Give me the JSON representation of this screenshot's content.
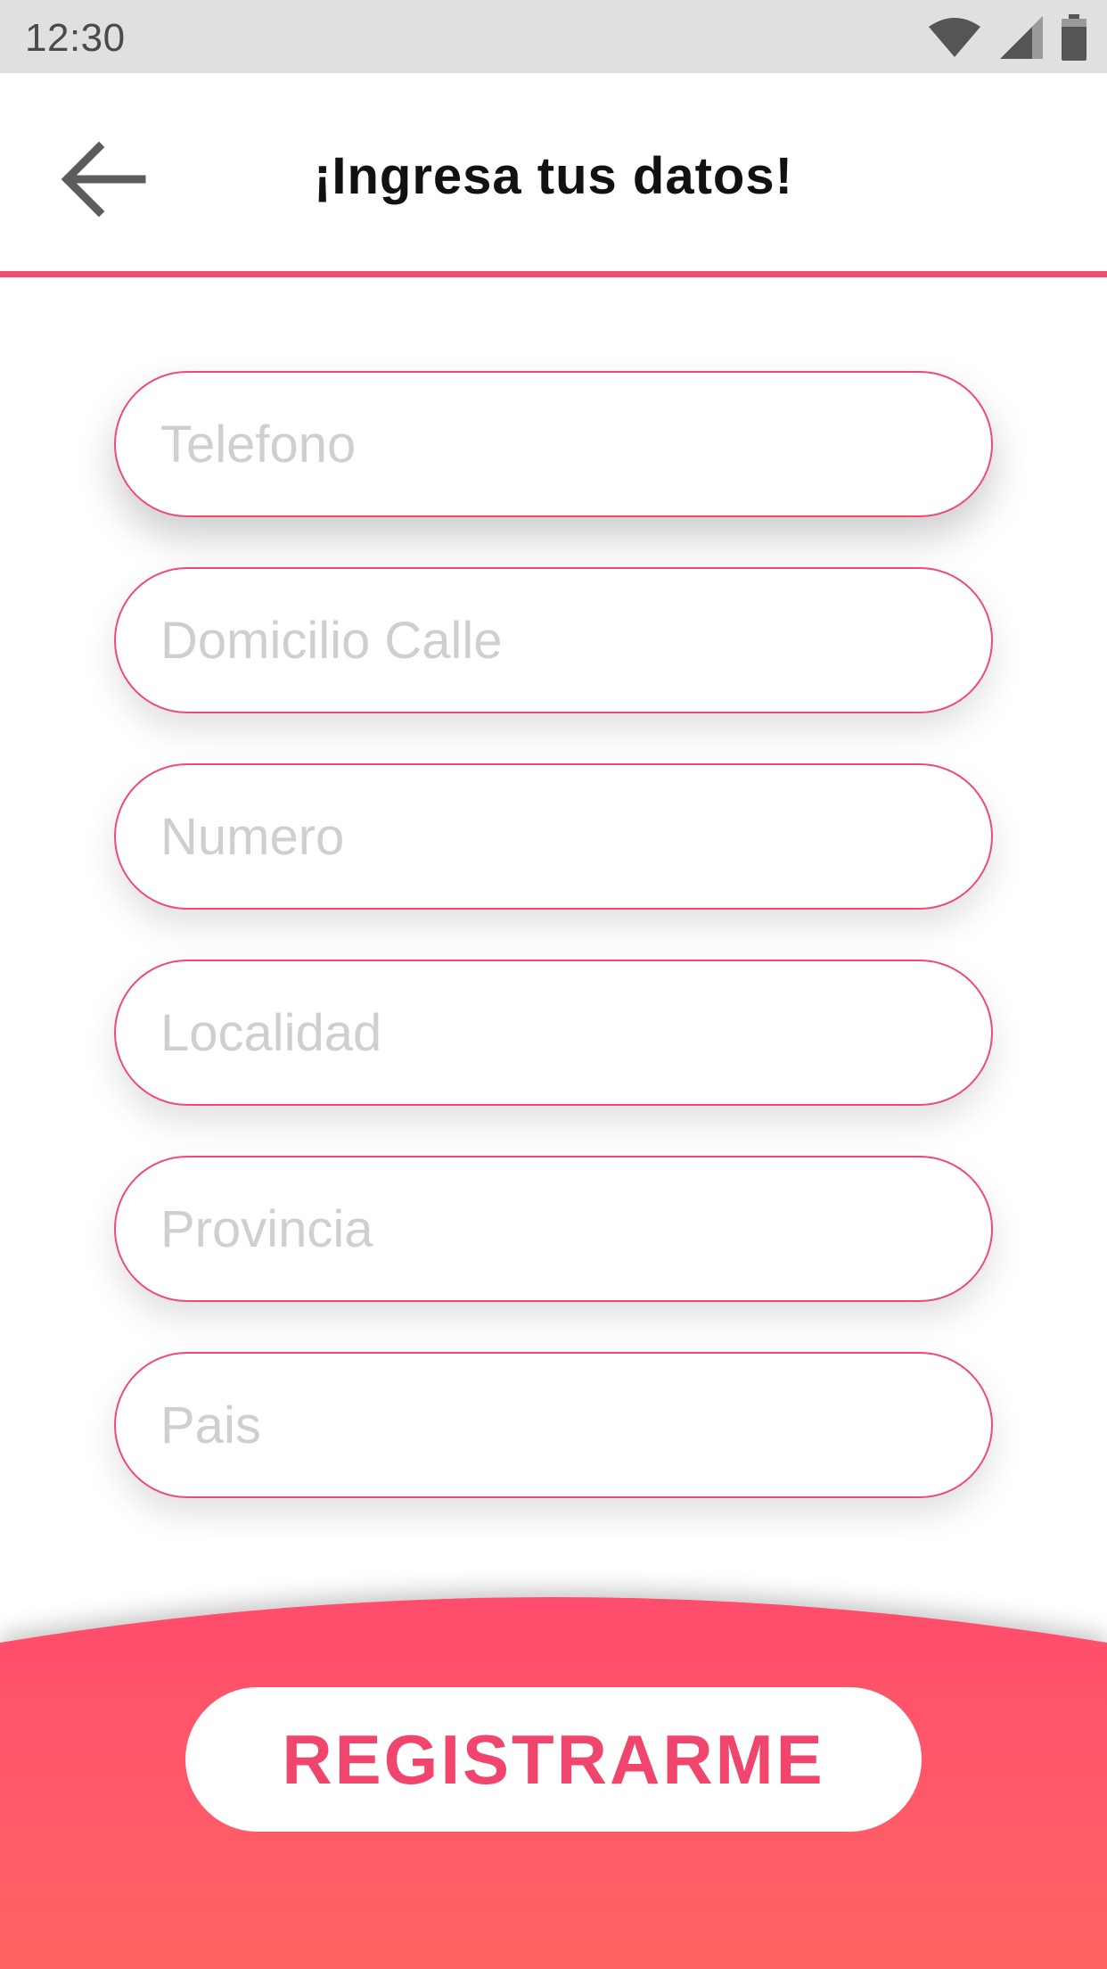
{
  "status_bar": {
    "time": "12:30",
    "icons": [
      "wifi-icon",
      "signal-icon",
      "battery-icon"
    ]
  },
  "header": {
    "back_icon": "arrow-left-icon",
    "title": "¡Ingresa tus datos!"
  },
  "form": {
    "fields": [
      {
        "placeholder": "Telefono",
        "value": ""
      },
      {
        "placeholder": "Domicilio Calle",
        "value": ""
      },
      {
        "placeholder": "Numero",
        "value": ""
      },
      {
        "placeholder": "Localidad",
        "value": ""
      },
      {
        "placeholder": "Provincia",
        "value": ""
      },
      {
        "placeholder": "Pais",
        "value": ""
      }
    ]
  },
  "footer": {
    "register_label": "REGISTRARME"
  },
  "colors": {
    "accent": "#f0506e",
    "gradient_top": "#ff4d6d",
    "gradient_bottom": "#ff6363",
    "status_bar_bg": "#e0e0e0"
  }
}
